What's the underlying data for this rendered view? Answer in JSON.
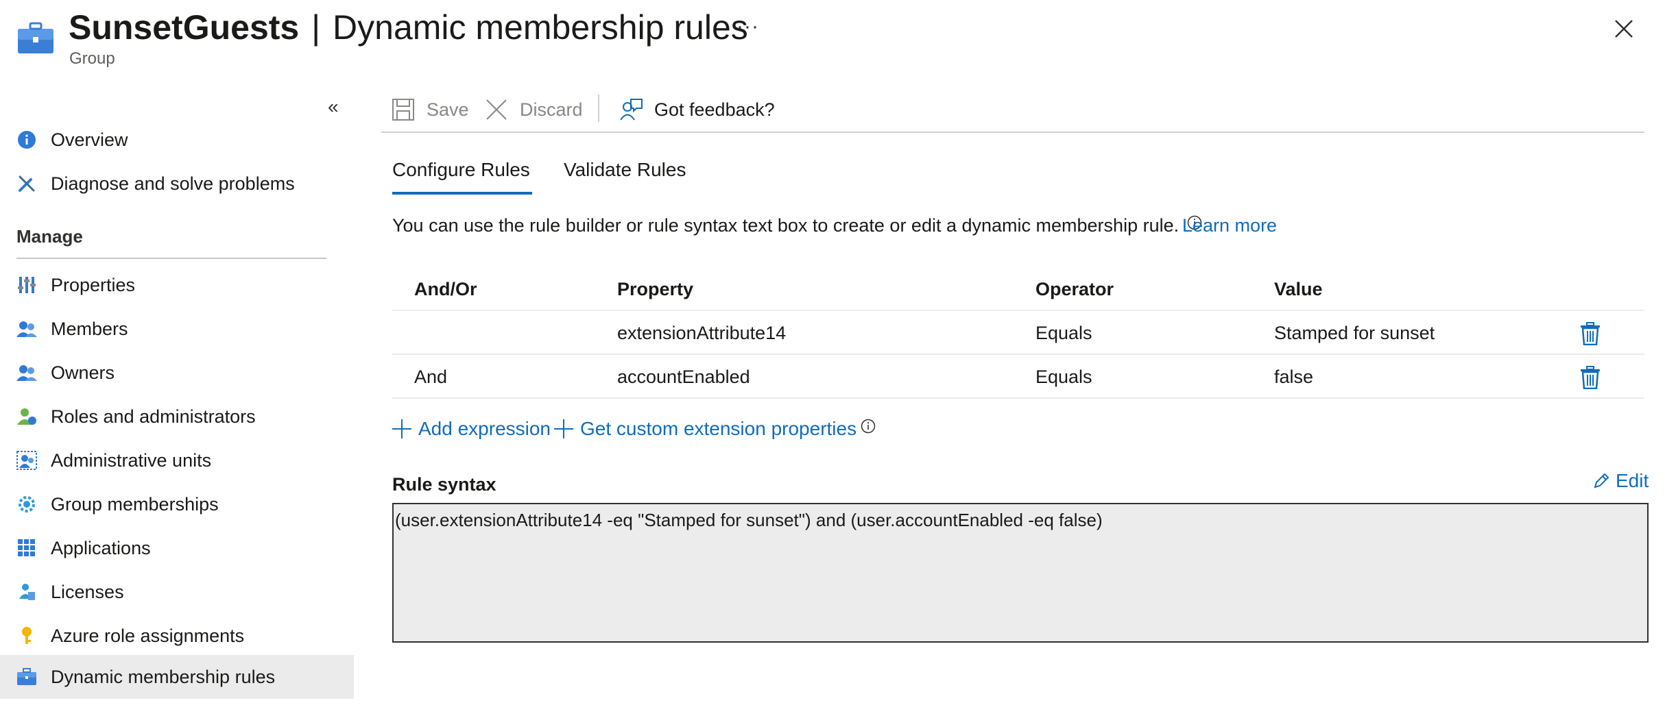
{
  "header": {
    "group_name": "SunsetGuests",
    "separator": "|",
    "page_name": "Dynamic membership rules",
    "subtitle": "Group",
    "more": "···"
  },
  "sidebar": {
    "manage_label": "Manage",
    "items": [
      {
        "label": "Overview",
        "icon": "info-icon"
      },
      {
        "label": "Diagnose and solve problems",
        "icon": "wrench-icon"
      },
      {
        "label": "Properties",
        "icon": "properties-icon"
      },
      {
        "label": "Members",
        "icon": "members-icon"
      },
      {
        "label": "Owners",
        "icon": "owners-icon"
      },
      {
        "label": "Roles and administrators",
        "icon": "roles-icon"
      },
      {
        "label": "Administrative units",
        "icon": "admin-units-icon"
      },
      {
        "label": "Group memberships",
        "icon": "group-memberships-icon"
      },
      {
        "label": "Applications",
        "icon": "applications-icon"
      },
      {
        "label": "Licenses",
        "icon": "licenses-icon"
      },
      {
        "label": "Azure role assignments",
        "icon": "key-icon"
      },
      {
        "label": "Dynamic membership rules",
        "icon": "briefcase-icon",
        "active": true
      }
    ]
  },
  "toolbar": {
    "save_label": "Save",
    "discard_label": "Discard",
    "feedback_label": "Got feedback?"
  },
  "tabs": [
    {
      "label": "Configure Rules",
      "active": true
    },
    {
      "label": "Validate Rules",
      "active": false
    }
  ],
  "intro": {
    "text": "You can use the rule builder or rule syntax text box to create or edit a dynamic membership rule.",
    "learn_more": "Learn more"
  },
  "table": {
    "headers": [
      "And/Or",
      "Property",
      "Operator",
      "Value"
    ],
    "rows": [
      {
        "andor": "",
        "property": "extensionAttribute14",
        "operator": "Equals",
        "value": "Stamped for sunset"
      },
      {
        "andor": "And",
        "property": "accountEnabled",
        "operator": "Equals",
        "value": "false"
      }
    ]
  },
  "actions": {
    "add_expression": "Add expression",
    "get_custom": "Get custom extension properties"
  },
  "rule_syntax": {
    "label": "Rule syntax",
    "edit": "Edit",
    "value": "(user.extensionAttribute14 -eq \"Stamped for sunset\") and (user.accountEnabled -eq false)"
  },
  "colors": {
    "accent": "#0f6cbd",
    "active_nav_bg": "#ebebeb",
    "rule_box_bg": "#ececec"
  }
}
